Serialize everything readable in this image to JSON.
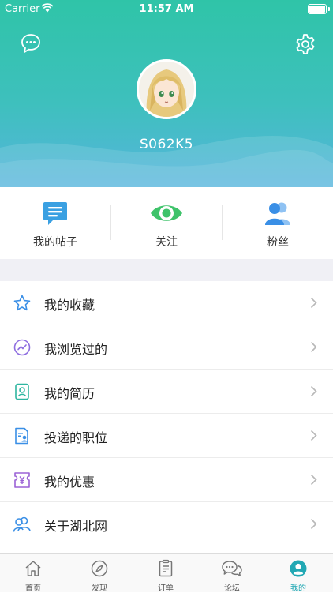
{
  "status_bar": {
    "carrier": "Carrier",
    "time": "11:57 AM"
  },
  "profile": {
    "username": "S062K5"
  },
  "stats": [
    {
      "label": "我的帖子",
      "icon": "post-icon"
    },
    {
      "label": "关注",
      "icon": "eye-icon"
    },
    {
      "label": "粉丝",
      "icon": "fans-icon"
    }
  ],
  "menu": [
    {
      "label": "我的收藏",
      "icon": "star-icon"
    },
    {
      "label": "我浏览过的",
      "icon": "history-icon"
    },
    {
      "label": "我的简历",
      "icon": "resume-icon"
    },
    {
      "label": "投递的职位",
      "icon": "job-icon"
    },
    {
      "label": "我的优惠",
      "icon": "coupon-icon"
    },
    {
      "label": "关于湖北网",
      "icon": "about-icon"
    }
  ],
  "tabbar": [
    {
      "label": "首页",
      "icon": "home-icon"
    },
    {
      "label": "发现",
      "icon": "compass-icon"
    },
    {
      "label": "订单",
      "icon": "order-icon"
    },
    {
      "label": "论坛",
      "icon": "forum-icon"
    },
    {
      "label": "我的",
      "icon": "profile-icon",
      "active": true
    }
  ],
  "colors": {
    "accent": "#22a8b4",
    "header_top": "#2fc4a8",
    "header_bottom": "#56b5dd"
  }
}
